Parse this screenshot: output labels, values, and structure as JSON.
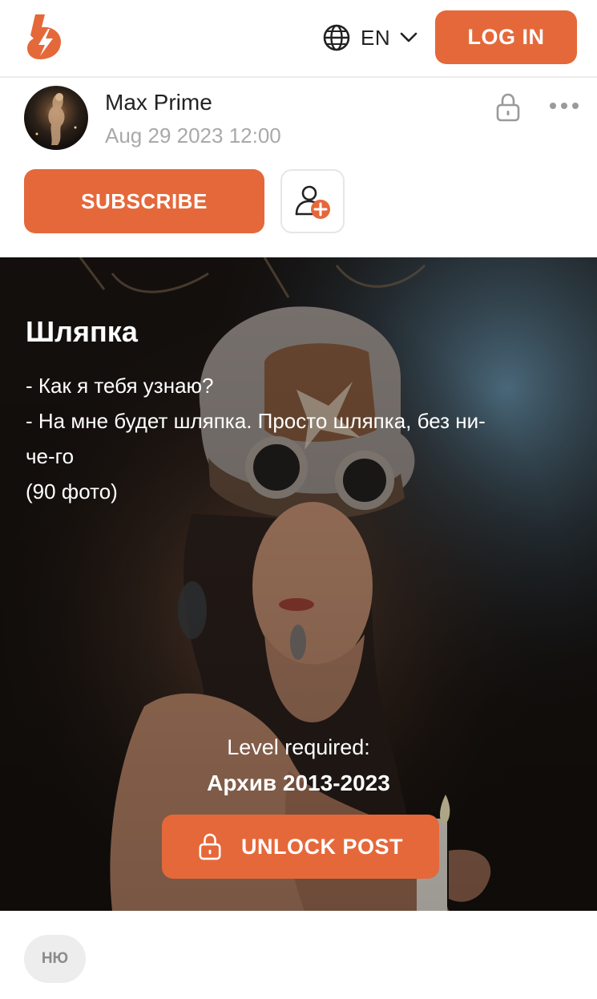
{
  "header": {
    "language": "EN",
    "login_label": "LOG IN"
  },
  "author": {
    "name": "Max Prime",
    "date": "Aug 29 2023 12:00"
  },
  "actions": {
    "subscribe_label": "SUBSCRIBE"
  },
  "post": {
    "title": "Шляпка",
    "lines": [
      "- Как я тебя узнаю?",
      "- На мне будет шляпка. Просто шляпка, без ни-",
      "че-го",
      "(90 фото)"
    ],
    "level_label": "Level required:",
    "level_name": "Архив 2013-2023",
    "unlock_label": "UNLOCK POST"
  },
  "tags": [
    "НЮ"
  ],
  "colors": {
    "accent": "#e5683a",
    "muted_text": "#a9a9a9",
    "tag_bg": "#ededed"
  },
  "icons": [
    "logo-icon",
    "globe-icon",
    "chevron-down-icon",
    "lock-icon",
    "more-icon",
    "add-user-icon"
  ]
}
